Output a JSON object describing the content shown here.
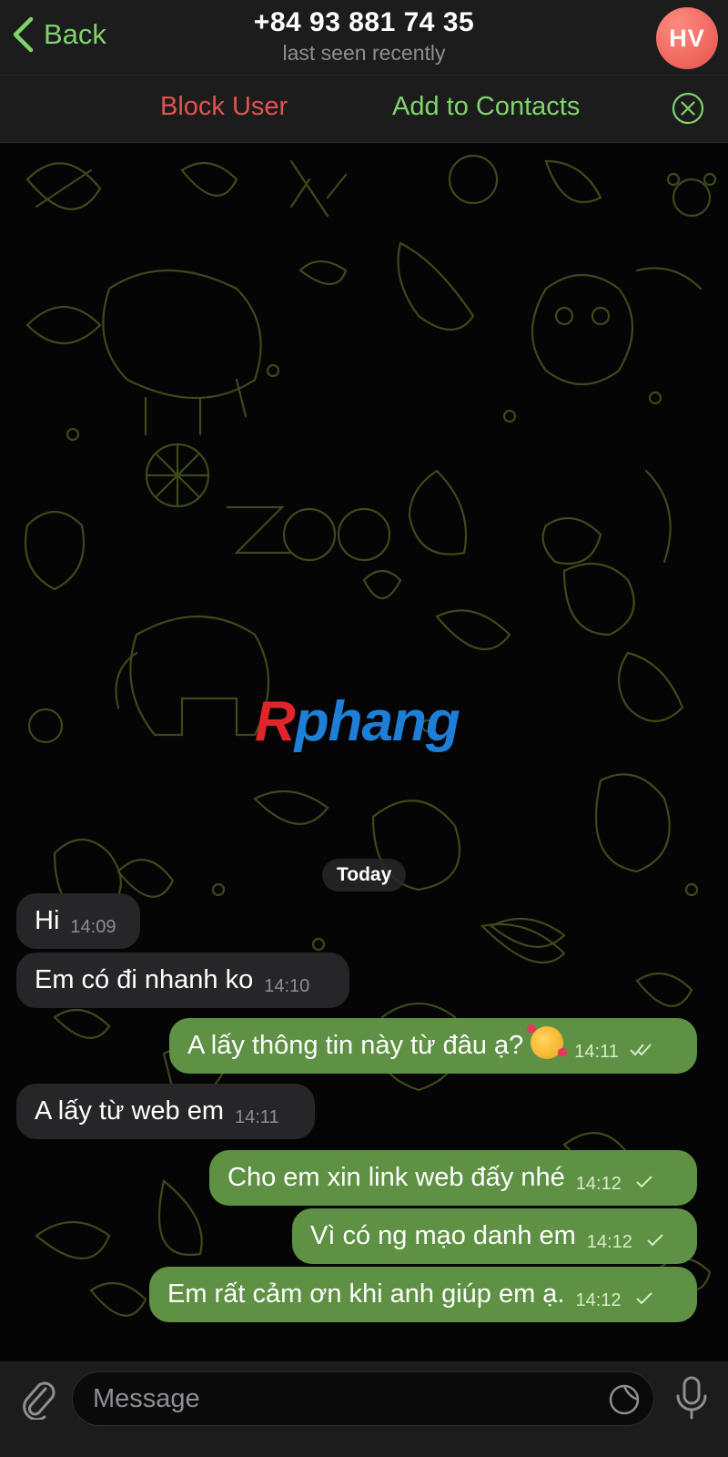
{
  "header": {
    "back_label": "Back",
    "title": "+84 93 881 74 35",
    "subtitle": "last seen recently",
    "avatar_initials": "HV"
  },
  "actions": {
    "block_label": "Block User",
    "add_label": "Add to Contacts"
  },
  "chat": {
    "watermark_part1": "R",
    "watermark_part2": "phang",
    "date_label": "Today",
    "messages": [
      {
        "direction": "in",
        "text": "Hi",
        "time": "14:09"
      },
      {
        "direction": "in",
        "text": "Em có đi nhanh ko",
        "time": "14:10"
      },
      {
        "direction": "out",
        "text": "A lấy thông tin này từ đâu ạ?",
        "emoji": "smiling-face-with-hearts",
        "time": "14:11",
        "status": "read"
      },
      {
        "direction": "in",
        "text": "A lấy từ web em",
        "time": "14:11"
      },
      {
        "direction": "out",
        "text": "Cho em xin link web đấy nhé",
        "time": "14:12",
        "status": "sent"
      },
      {
        "direction": "out",
        "text": "Vì có ng mạo danh em",
        "time": "14:12",
        "status": "sent"
      },
      {
        "direction": "out",
        "text": "Em rất cảm ơn khi anh giúp em ạ.",
        "time": "14:12",
        "status": "sent"
      }
    ]
  },
  "input": {
    "placeholder": "Message"
  },
  "colors": {
    "accent_green": "#7fd46a",
    "block_red": "#e3524f",
    "outgoing_bubble": "#5e9143",
    "incoming_bubble": "#262628",
    "doodle_stroke": "#3c4a1c"
  }
}
